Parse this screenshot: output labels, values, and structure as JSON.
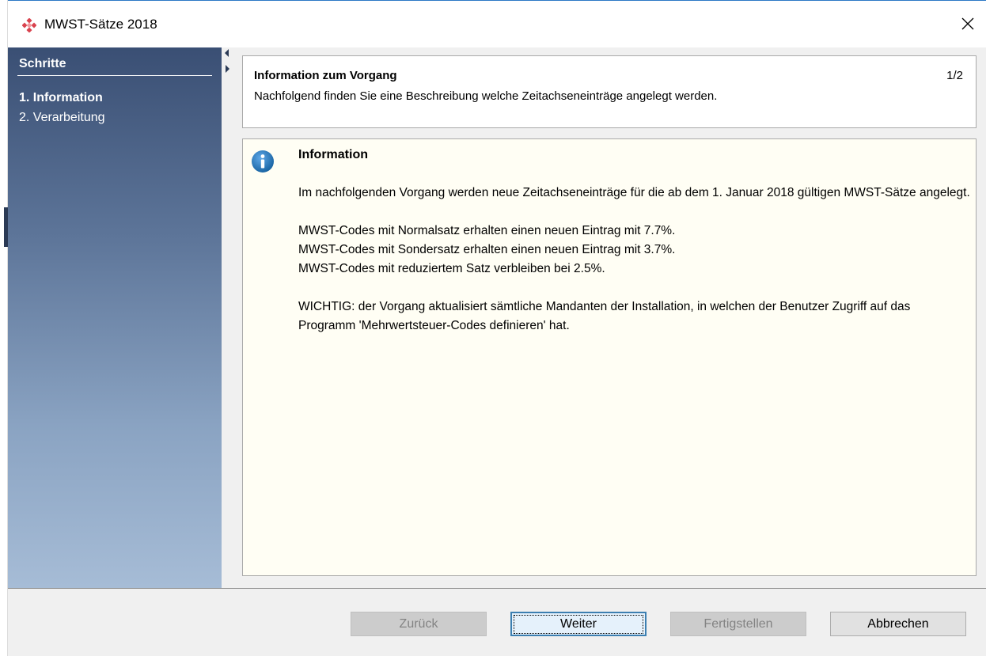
{
  "window": {
    "title": "MWST-Sätze 2018",
    "close_glyph": "✕"
  },
  "sidebar": {
    "title": "Schritte",
    "steps": [
      {
        "label": "1. Information",
        "active": true
      },
      {
        "label": "2. Verarbeitung",
        "active": false
      }
    ]
  },
  "header": {
    "title": "Information zum Vorgang",
    "page_indicator": "1/2",
    "description": "Nachfolgend finden Sie eine Beschreibung welche Zeitachseneinträge angelegt werden."
  },
  "info": {
    "icon": "info-icon",
    "title": "Information",
    "paragraphs": [
      "Im nachfolgenden Vorgang werden neue Zeitachseneinträge für die ab dem 1. Januar 2018 gültigen MWST-Sätze angelegt.",
      "MWST-Codes mit Normalsatz erhalten einen neuen Eintrag mit 7.7%.",
      "MWST-Codes mit Sondersatz erhalten einen neuen Eintrag mit 3.7%.",
      "MWST-Codes mit reduziertem Satz verbleiben bei 2.5%.",
      "WICHTIG: der Vorgang aktualisiert sämtliche Mandanten der Installation, in welchen der Benutzer Zugriff auf das Programm 'Mehrwertsteuer-Codes definieren' hat."
    ]
  },
  "buttons": {
    "back": "Zurück",
    "next": "Weiter",
    "finish": "Fertigstellen",
    "cancel": "Abbrechen"
  },
  "colors": {
    "sidebar_top": "#3a4f74",
    "sidebar_bottom": "#a6bcd6",
    "info_background": "#fffef4",
    "default_button_border": "#3c7fb1"
  }
}
